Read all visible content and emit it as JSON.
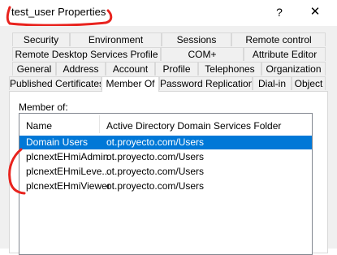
{
  "window": {
    "title": "test_user Properties",
    "help_glyph": "?",
    "close_glyph": "✕"
  },
  "tabs": {
    "row1": [
      "Security",
      "Environment",
      "Sessions",
      "Remote control"
    ],
    "row2": [
      "Remote Desktop Services Profile",
      "COM+",
      "Attribute Editor"
    ],
    "row3": [
      "General",
      "Address",
      "Account",
      "Profile",
      "Telephones",
      "Organization"
    ],
    "row4": [
      "Published Certificates",
      "Member Of",
      "Password Replication",
      "Dial-in",
      "Object"
    ],
    "active": "Member Of"
  },
  "member_of": {
    "label": "Member of:",
    "columns": [
      "Name",
      "Active Directory Domain Services Folder"
    ],
    "rows": [
      {
        "name": "Domain Users",
        "folder": "ot.proyecto.com/Users",
        "selected": true
      },
      {
        "name": "plcnextEHmiAdmin",
        "folder": "ot.proyecto.com/Users",
        "selected": false
      },
      {
        "name": "plcnextEHmiLeve...",
        "folder": "ot.proyecto.com/Users",
        "selected": false
      },
      {
        "name": "plcnextEHmiViewer",
        "folder": "ot.proyecto.com/Users",
        "selected": false
      }
    ]
  },
  "colors": {
    "selection": "#0078d7",
    "annotation": "#e8231e",
    "dialog_bg": "#f0f0f0"
  }
}
